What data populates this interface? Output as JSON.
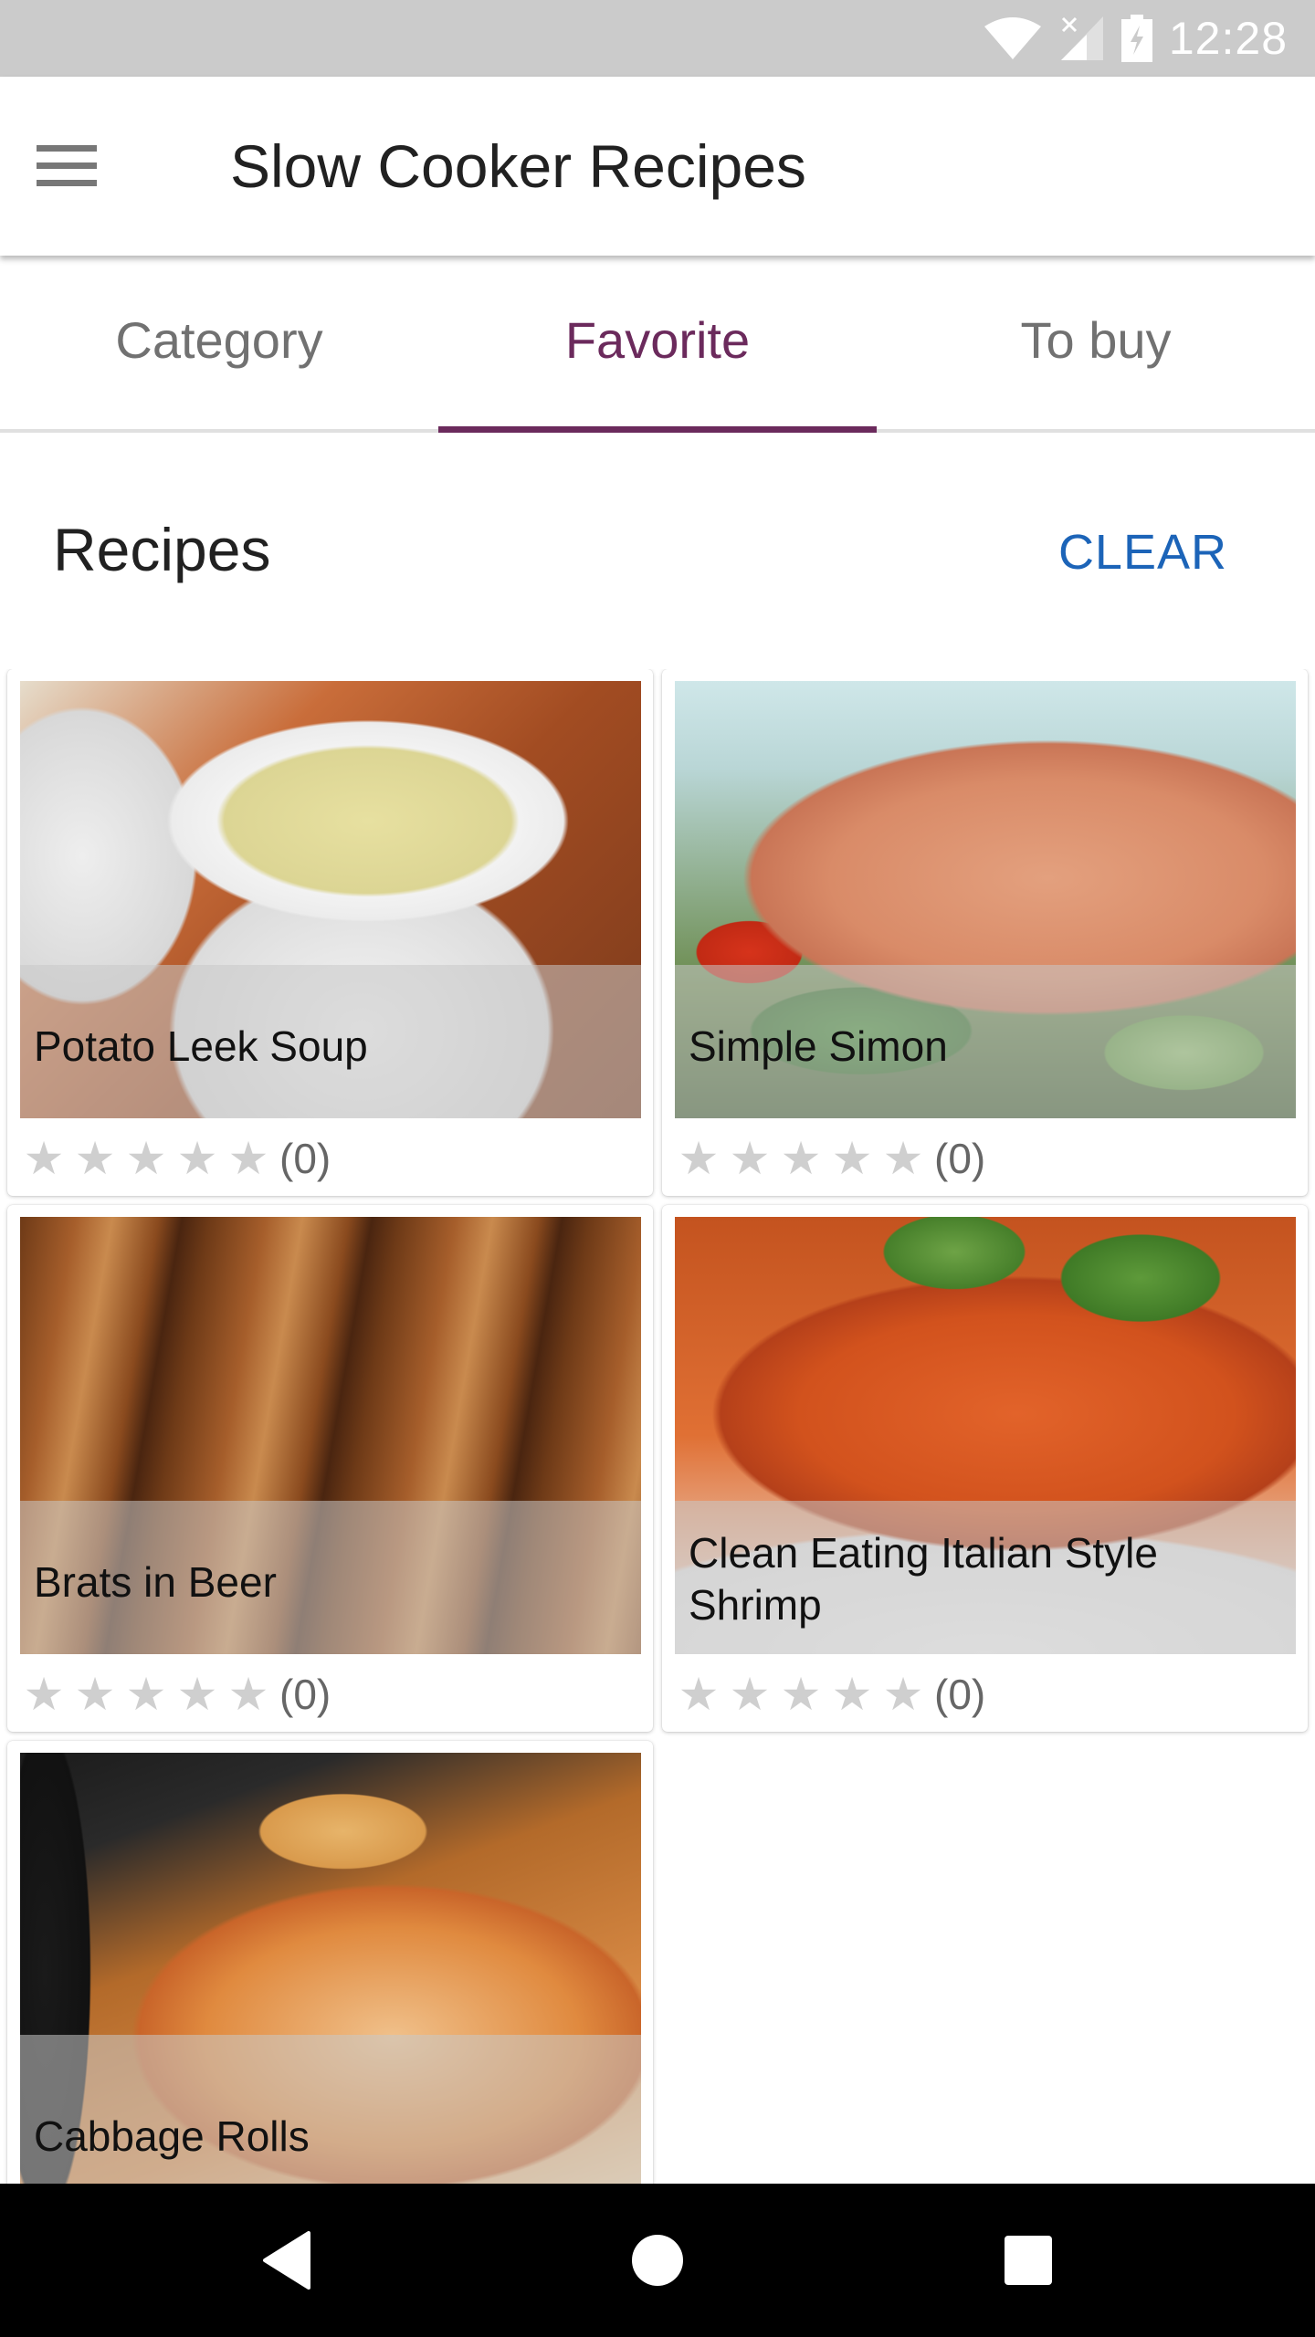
{
  "status_bar": {
    "time": "12:28",
    "icons": [
      "wifi-icon",
      "signal-no-service-icon",
      "battery-charging-icon"
    ]
  },
  "toolbar": {
    "menu_icon": "hamburger-menu-icon",
    "title": "Slow Cooker Recipes"
  },
  "tabs": [
    {
      "label": "Category",
      "active": false
    },
    {
      "label": "Favorite",
      "active": true
    },
    {
      "label": "To buy",
      "active": false
    }
  ],
  "section": {
    "title": "Recipes",
    "clear_label": "CLEAR"
  },
  "colors": {
    "accent": "#6b2a5c",
    "clear_button": "#1c64b8",
    "star_empty": "#cfcfcf",
    "status_bar": "#cbcbcb"
  },
  "recipes": [
    {
      "title": "Potato Leek Soup",
      "rating": 0,
      "max_rating": 5,
      "rating_count": "(0)"
    },
    {
      "title": "Simple Simon",
      "rating": 0,
      "max_rating": 5,
      "rating_count": "(0)"
    },
    {
      "title": "Brats in Beer",
      "rating": 0,
      "max_rating": 5,
      "rating_count": "(0)"
    },
    {
      "title": "Clean Eating Italian Style Shrimp",
      "rating": 0,
      "max_rating": 5,
      "rating_count": "(0)"
    },
    {
      "title": "Cabbage Rolls"
    }
  ],
  "nav_bar": {
    "back": "back-icon",
    "home": "home-icon",
    "recent": "recent-apps-icon"
  }
}
